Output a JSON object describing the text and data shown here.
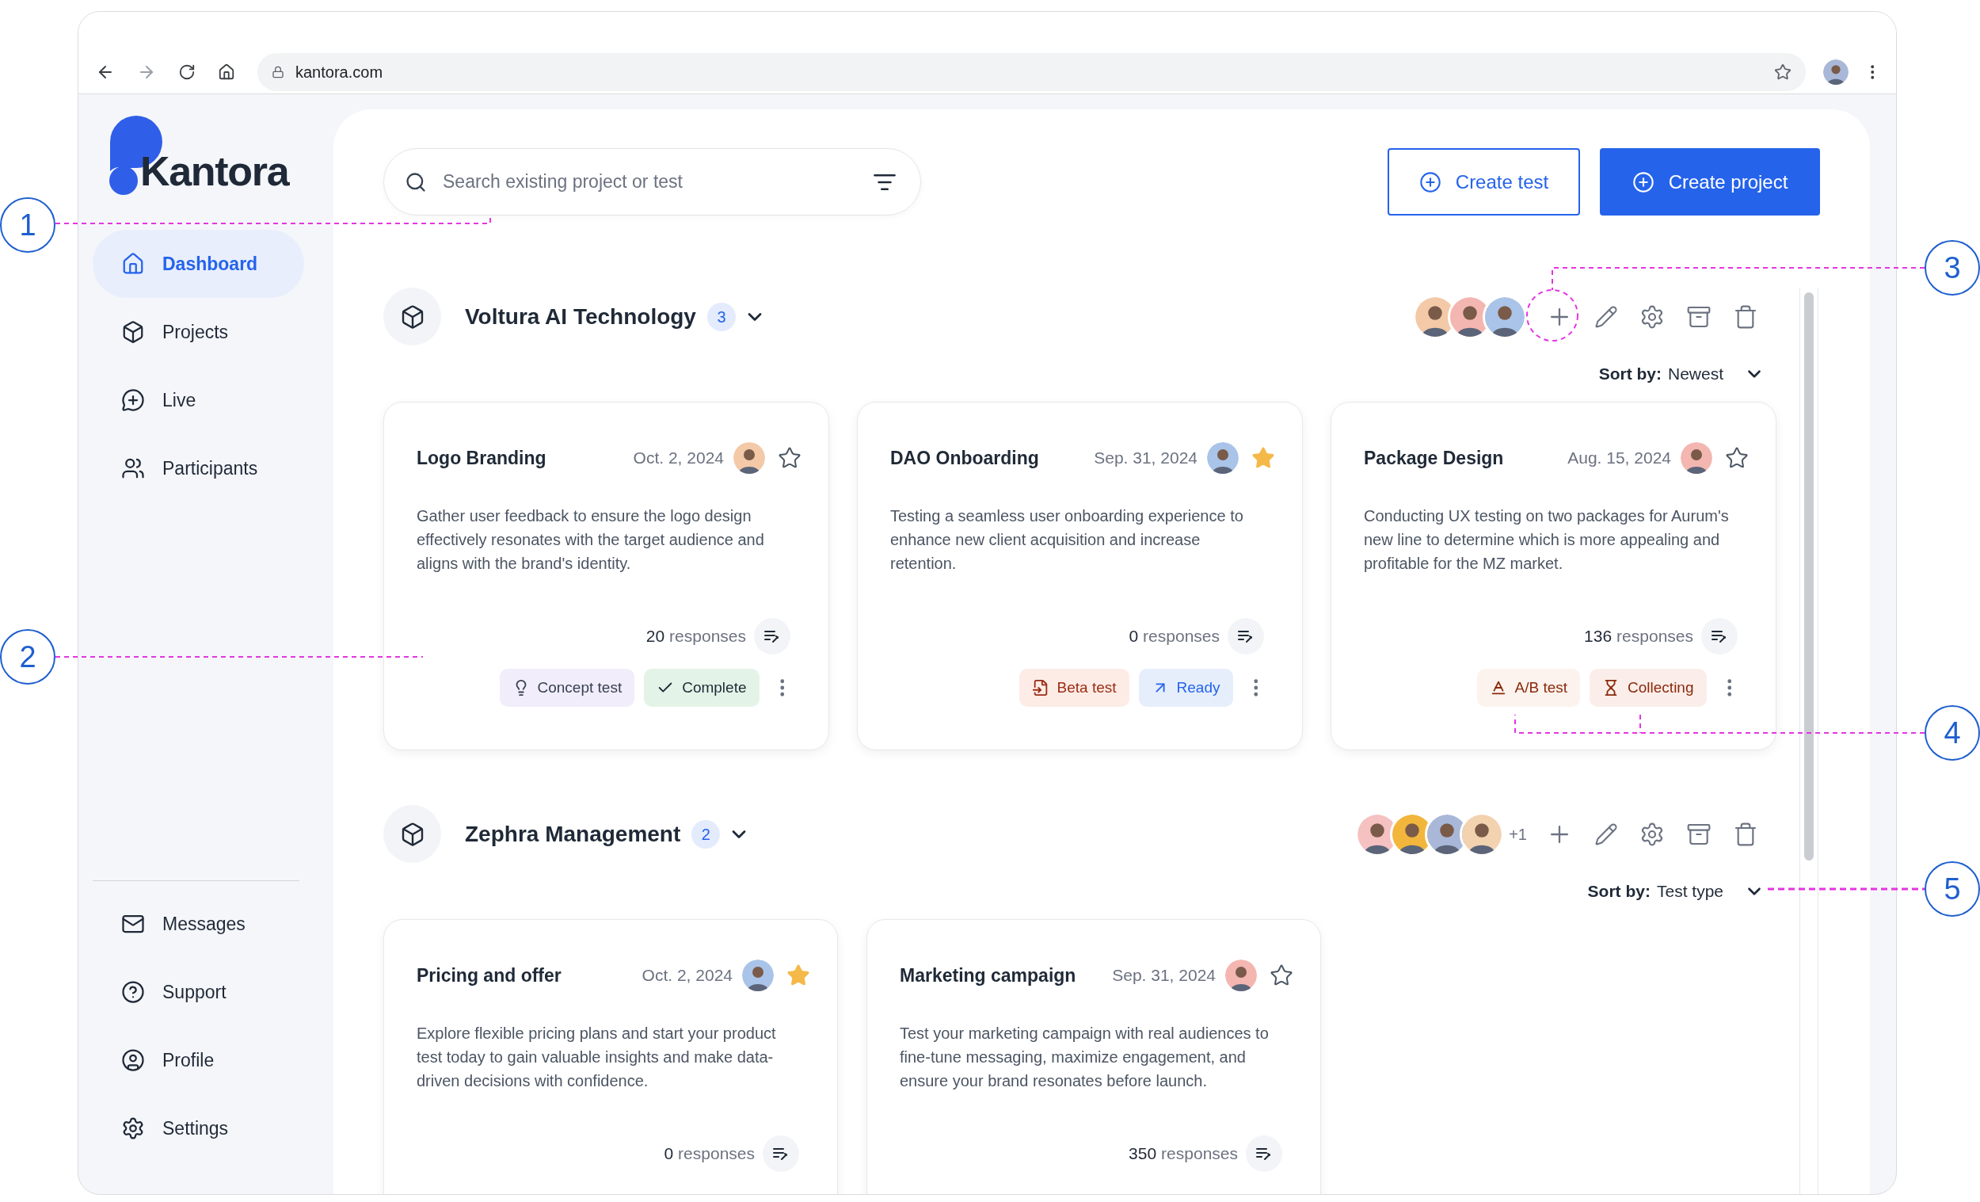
{
  "browser": {
    "url": "kantora.com"
  },
  "logo": {
    "text": "Kantora"
  },
  "sidebar": {
    "items": [
      {
        "label": "Dashboard",
        "kind": "home",
        "selected": true
      },
      {
        "label": "Projects",
        "kind": "box",
        "selected": false
      },
      {
        "label": "Live",
        "kind": "live",
        "selected": false
      },
      {
        "label": "Participants",
        "kind": "users",
        "selected": false
      }
    ],
    "bottom_items": [
      {
        "label": "Messages",
        "kind": "mail",
        "selected": false
      },
      {
        "label": "Support",
        "kind": "help",
        "selected": false
      },
      {
        "label": "Profile",
        "kind": "profile",
        "selected": false
      },
      {
        "label": "Settings",
        "kind": "settings",
        "selected": false
      }
    ]
  },
  "search": {
    "placeholder": "Search existing project or test"
  },
  "actions": [
    {
      "label": "Create test",
      "kind": "outline"
    },
    {
      "label": "Create project",
      "kind": "filled"
    }
  ],
  "projects": [
    {
      "name": "Voltura AI Technology",
      "count": "3",
      "sort_label": "Sort by:",
      "sort_value": "Newest",
      "members": [
        {
          "color": "#f3c9a8"
        },
        {
          "color": "#f4b6b0"
        },
        {
          "color": "#a9c4e8"
        }
      ],
      "cards": [
        {
          "title": "Logo Branding",
          "date": "Oct. 2, 2024",
          "avatar": {
            "color": "#f3c9a8"
          },
          "favorite": false,
          "description": "Gather user feedback to ensure the logo design effectively resonates with the target audience and aligns with the brand's identity.",
          "responses": "20",
          "responses_label": "responses",
          "tags": [
            {
              "label": "Concept test",
              "kind": "concept"
            },
            {
              "label": "Complete",
              "kind": "complete"
            }
          ]
        },
        {
          "title": "DAO Onboarding",
          "date": "Sep. 31, 2024",
          "avatar": {
            "color": "#a9c4e8"
          },
          "favorite": true,
          "description": "Testing a seamless user onboarding experience to enhance new client acquisition and increase retention.",
          "responses": "0",
          "responses_label": "responses",
          "tags": [
            {
              "label": "Beta test",
              "kind": "beta"
            },
            {
              "label": "Ready",
              "kind": "ready"
            }
          ]
        },
        {
          "title": "Package Design",
          "date": "Aug. 15, 2024",
          "avatar": {
            "color": "#f4b6b0"
          },
          "favorite": false,
          "description": "Conducting UX testing on two packages for Aurum's new line to determine which is more appealing and profitable for the MZ market.",
          "responses": "136",
          "responses_label": "responses",
          "tags": [
            {
              "label": "A/B test",
              "kind": "ab"
            },
            {
              "label": "Collecting",
              "kind": "collecting"
            }
          ]
        }
      ]
    },
    {
      "name": "Zephra Management",
      "count": "2",
      "sort_label": "Sort by:",
      "sort_value": "Test type",
      "extra_members": "+1",
      "members": [
        {
          "color": "#f6c1c1"
        },
        {
          "color": "#f2b63c"
        },
        {
          "color": "#a9b8d8"
        },
        {
          "color": "#f3d2b0"
        }
      ],
      "cards": [
        {
          "title": "Pricing and offer",
          "date": "Oct. 2, 2024",
          "avatar": {
            "color": "#a9c4e8"
          },
          "favorite": true,
          "description": "Explore flexible pricing plans and start your product test today to gain valuable insights and make data-driven decisions with confidence.",
          "responses": "0",
          "responses_label": "responses"
        },
        {
          "title": "Marketing campaign",
          "date": "Sep. 31, 2024",
          "avatar": {
            "color": "#f4b6b0"
          },
          "favorite": false,
          "description": "Test your marketing campaign with real audiences to fine-tune messaging, maximize engagement, and ensure your brand resonates before launch.",
          "responses": "350",
          "responses_label": "responses"
        }
      ]
    }
  ],
  "callouts": [
    {
      "number": "1"
    },
    {
      "number": "2"
    },
    {
      "number": "3"
    },
    {
      "number": "4"
    },
    {
      "number": "5"
    }
  ]
}
